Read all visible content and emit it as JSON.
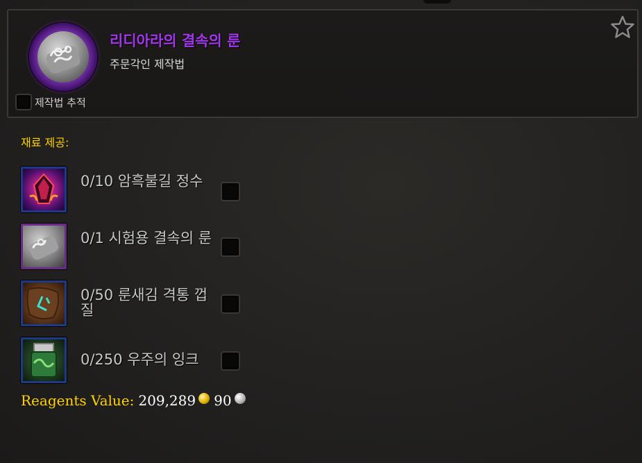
{
  "recipe": {
    "title": "리디아라의 결속의 룬",
    "subtitle": "주문각인 제작법",
    "track_label": "제작법 추적",
    "favorite_icon": "star-outline-icon",
    "icon": "rune-icon",
    "title_color": "#a335ee"
  },
  "reagents_section": {
    "label": "재료 제공:",
    "items": [
      {
        "text": "0/10 암흑불길 정수",
        "icon": "dark-flame-essence-icon"
      },
      {
        "text": "0/1 시험용 결속의 룬",
        "icon": "rune-icon"
      },
      {
        "text": "0/50 룬새김 격통 껍질",
        "icon": "runed-hide-icon"
      },
      {
        "text": "0/250 우주의 잉크",
        "icon": "cosmic-ink-icon"
      }
    ]
  },
  "reagents_value": {
    "label": "Reagents Value:",
    "gold": "209,289",
    "silver": "90",
    "gold_icon": "gold-coin-icon",
    "silver_icon": "silver-coin-icon"
  },
  "colors": {
    "label_gold": "#ffd200",
    "epic_purple": "#a335ee",
    "rare_blue": "#1d3a86"
  }
}
